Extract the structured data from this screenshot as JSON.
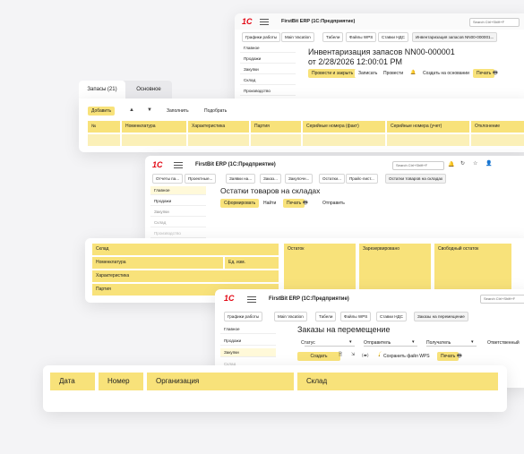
{
  "win1": {
    "app_title": "FirstBit ERP (1С:Предприятие)",
    "search_placeholder": "Search Ctrl+Shift+F",
    "tabs": [
      "Графики работы",
      "Main Vacation",
      "Табели",
      "Файлы WPS",
      "Ставки НДС",
      "Инвентаризация запасов NN00-000001..."
    ],
    "sidebar": [
      "Главное",
      "Продажи",
      "Закупки",
      "Склад",
      "Производство"
    ],
    "doc_title_line1": "Инвентаризация запасов NN00-000001",
    "doc_title_line2": "от 2/28/2026 12:00:01 PM",
    "toolbar": {
      "post_close": "Провести и закрыть",
      "save": "Записать",
      "post": "Провести",
      "create_based": "Создать на основании",
      "print": "Печать"
    }
  },
  "panel1": {
    "tabs": [
      "Запасы (21)",
      "Основное"
    ],
    "toolbar": {
      "add": "Добавить",
      "up": "▲",
      "down": "▼",
      "fill": "Заполнить",
      "select": "Подобрать"
    },
    "columns": [
      "№",
      "Номенклатура",
      "Характеристика",
      "Партия",
      "Серийные номера (факт)",
      "Серийные номера (учет)",
      "Отклонение"
    ]
  },
  "win2": {
    "app_title": "FirstBit ERP (1С:Предприятие)",
    "search_placeholder": "Search Ctrl+Shift+F",
    "tabs": [
      "Отчеты па...",
      "Проектные...",
      "Заявки на...",
      "Заказ...",
      "Закупочн...",
      "Остатки...",
      "Прайс-лист...",
      "Остатки товаров на складах"
    ],
    "sidebar": [
      "Главное",
      "Продажи",
      "Закупки",
      "Склад",
      "Производство"
    ],
    "report_title": "Остатки товаров на складах",
    "toolbar": {
      "generate": "Сформировать",
      "find": "Найти",
      "print": "Печать",
      "send": "Отправить"
    }
  },
  "panel2": {
    "left_rows": [
      "Склад",
      "Номенклатура",
      "Характеристика",
      "Партия"
    ],
    "unit": "Ед. изм.",
    "cols": [
      "Остаток",
      "Зарезервировано",
      "Свободный остаток"
    ]
  },
  "win3": {
    "app_title": "FirstBit ERP (1С:Предприятие)",
    "search_placeholder": "Search Ctrl+Shift+F",
    "tabs": [
      "Графики работы",
      "Main Vacation",
      "Табели",
      "Файлы WPS",
      "Ставки НДС",
      "Заказы на перемещение"
    ],
    "sidebar": [
      "Главное",
      "Продажи",
      "Закупки",
      "Склад"
    ],
    "list_title": "Заказы на перемещение",
    "filters": [
      "Статус",
      "Отправитель",
      "Получатель",
      "Ответственный"
    ],
    "toolbar": {
      "create": "Создать",
      "save_wps": "Сохранить файл WPS",
      "print": "Печать"
    }
  },
  "panel3": {
    "columns": [
      "Дата",
      "Номер",
      "Организация",
      "Склад"
    ]
  },
  "colors": {
    "accent_yellow": "#f8e27a",
    "light_yellow": "#fbf0b8",
    "logo_red": "#e30613"
  }
}
